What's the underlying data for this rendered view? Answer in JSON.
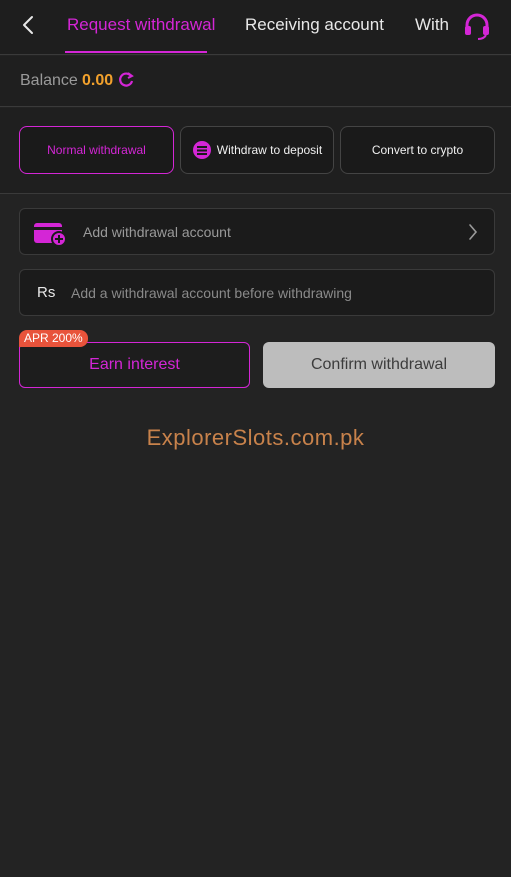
{
  "header": {
    "tabs": [
      {
        "label": "Request withdrawal",
        "active": true
      },
      {
        "label": "Receiving account",
        "active": false
      },
      {
        "label": "With",
        "active": false
      }
    ],
    "back_icon": "chevron-left-icon",
    "support_icon": "headset-icon"
  },
  "balance": {
    "label": "Balance",
    "value": "0.00",
    "refresh_icon": "refresh-icon"
  },
  "modes": [
    {
      "label": "Normal withdrawal",
      "active": true
    },
    {
      "label": "Withdraw to deposit",
      "active": false,
      "icon": "deposit-icon"
    },
    {
      "label": "Convert to crypto",
      "active": false
    }
  ],
  "account_field": {
    "label": "Add withdrawal account",
    "icon": "wallet-add-icon"
  },
  "amount_field": {
    "currency": "Rs",
    "placeholder": "Add a withdrawal account before withdrawing"
  },
  "actions": {
    "apr_badge": "APR 200%",
    "earn_label": "Earn interest",
    "confirm_label": "Confirm withdrawal"
  },
  "watermark": "ExplorerSlots.com.pk",
  "colors": {
    "accent": "#d426d6",
    "balance": "#f2a12c",
    "badge": "#e8533b",
    "background": "#232323"
  }
}
